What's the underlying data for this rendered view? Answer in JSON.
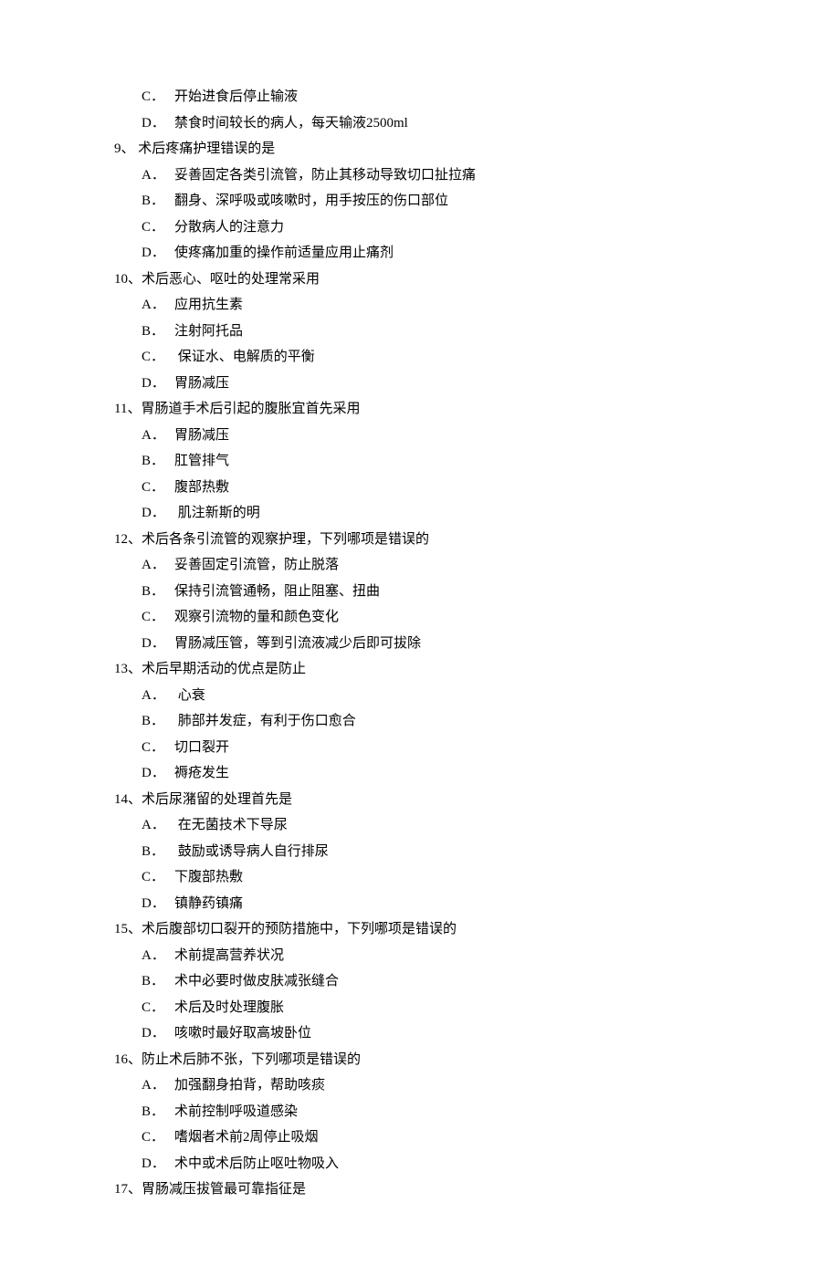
{
  "items": [
    {
      "type": "option",
      "letter": "C．",
      "text": "开始进食后停止输液"
    },
    {
      "type": "option",
      "letter": "D．",
      "text": "禁食时间较长的病人，每天输液2500ml"
    },
    {
      "type": "question",
      "text": "9、  术后疼痛护理错误的是"
    },
    {
      "type": "option",
      "letter": "A．",
      "text": "妥善固定各类引流管，防止其移动导致切口扯拉痛"
    },
    {
      "type": "option",
      "letter": "B．",
      "text": "翻身、深呼吸或咳嗽时，用手按压的伤口部位"
    },
    {
      "type": "option",
      "letter": "C．",
      "text": "分散病人的注意力"
    },
    {
      "type": "option",
      "letter": "D．",
      "text": "使疼痛加重的操作前适量应用止痛剂"
    },
    {
      "type": "question",
      "text": "10、术后恶心、呕吐的处理常采用"
    },
    {
      "type": "option",
      "letter": "A．",
      "text": "应用抗生素"
    },
    {
      "type": "option",
      "letter": "B．",
      "text": "注射阿托品"
    },
    {
      "type": "option",
      "letter": "C．",
      "text": " 保证水、电解质的平衡"
    },
    {
      "type": "option",
      "letter": "D．",
      "text": "胃肠减压"
    },
    {
      "type": "question",
      "text": "11、胃肠道手术后引起的腹胀宜首先采用"
    },
    {
      "type": "option",
      "letter": "A．",
      "text": "胃肠减压"
    },
    {
      "type": "option",
      "letter": "B．",
      "text": "肛管排气"
    },
    {
      "type": "option",
      "letter": "C．",
      "text": "腹部热敷"
    },
    {
      "type": "option",
      "letter": "D．",
      "text": " 肌注新斯的明"
    },
    {
      "type": "question",
      "text": "12、术后各条引流管的观察护理，下列哪项是错误的"
    },
    {
      "type": "option",
      "letter": "A．",
      "text": "妥善固定引流管，防止脱落"
    },
    {
      "type": "option",
      "letter": "B．",
      "text": "保持引流管通畅，阻止阻塞、扭曲"
    },
    {
      "type": "option",
      "letter": "C．",
      "text": "观察引流物的量和颜色变化"
    },
    {
      "type": "option",
      "letter": "D．",
      "text": "胃肠减压管，等到引流液减少后即可拔除"
    },
    {
      "type": "question",
      "text": "13、术后早期活动的优点是防止"
    },
    {
      "type": "option",
      "letter": "A．",
      "text": " 心衰"
    },
    {
      "type": "option",
      "letter": "B．",
      "text": " 肺部并发症，有利于伤口愈合"
    },
    {
      "type": "option",
      "letter": "C．",
      "text": "切口裂开"
    },
    {
      "type": "option",
      "letter": "D．",
      "text": "褥疮发生"
    },
    {
      "type": "question",
      "text": "14、术后尿潴留的处理首先是"
    },
    {
      "type": "option",
      "letter": "A．",
      "text": " 在无菌技术下导尿"
    },
    {
      "type": "option",
      "letter": "B．",
      "text": " 鼓励或诱导病人自行排尿"
    },
    {
      "type": "option",
      "letter": "C．",
      "text": "下腹部热敷"
    },
    {
      "type": "option",
      "letter": "D．",
      "text": "镇静药镇痛"
    },
    {
      "type": "question",
      "text": "15、术后腹部切口裂开的预防措施中，下列哪项是错误的"
    },
    {
      "type": "option",
      "letter": "A．",
      "text": "术前提高营养状况"
    },
    {
      "type": "option",
      "letter": "B．",
      "text": "术中必要时做皮肤减张缝合"
    },
    {
      "type": "option",
      "letter": "C．",
      "text": "术后及时处理腹胀"
    },
    {
      "type": "option",
      "letter": "D．",
      "text": "咳嗽时最好取高坡卧位"
    },
    {
      "type": "question",
      "text": "16、防止术后肺不张，下列哪项是错误的"
    },
    {
      "type": "option",
      "letter": "A．",
      "text": "加强翻身拍背，帮助咳痰"
    },
    {
      "type": "option",
      "letter": "B．",
      "text": "术前控制呼吸道感染"
    },
    {
      "type": "option",
      "letter": "C．",
      "text": "嗜烟者术前2周停止吸烟"
    },
    {
      "type": "option",
      "letter": "D．",
      "text": "术中或术后防止呕吐物吸入"
    },
    {
      "type": "question",
      "text": "17、胃肠减压拔管最可靠指征是"
    }
  ]
}
